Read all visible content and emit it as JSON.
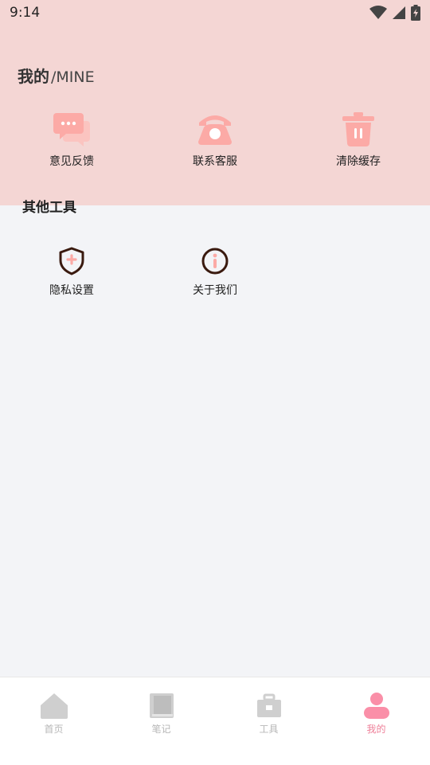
{
  "status": {
    "time": "9:14"
  },
  "header": {
    "title": "我的",
    "subtitle": "/MINE"
  },
  "grid1": [
    {
      "label": "意见反馈",
      "icon": "chat-bubbles-icon"
    },
    {
      "label": "联系客服",
      "icon": "telephone-icon"
    },
    {
      "label": "清除缓存",
      "icon": "trash-icon"
    }
  ],
  "section": {
    "title": "其他工具"
  },
  "grid2": [
    {
      "label": "隐私设置",
      "icon": "shield-plus-icon"
    },
    {
      "label": "关于我们",
      "icon": "info-circle-icon"
    }
  ],
  "tabs": [
    {
      "label": "首页",
      "icon": "home-icon"
    },
    {
      "label": "笔记",
      "icon": "notebook-icon"
    },
    {
      "label": "工具",
      "icon": "toolbox-icon"
    },
    {
      "label": "我的",
      "icon": "person-icon",
      "active": true
    }
  ],
  "colors": {
    "accent": "#fcaaa6",
    "header_bg": "#f4d6d4",
    "tab_active": "#ee7f98",
    "tab_inactive": "#cfcfcf",
    "icon_dark": "#3a1a0f"
  }
}
